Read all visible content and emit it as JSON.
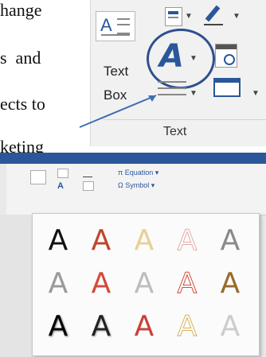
{
  "document": {
    "lines": [
      "hange",
      "s  and",
      "ects to",
      "keting"
    ]
  },
  "ribbon": {
    "text_box_label_1": "Text",
    "text_box_label_2": "Box",
    "text_box_icon_text": "A",
    "wordart_letter": "A",
    "group_label": "Text"
  },
  "inset": {
    "equation_label": "π Equation ▾",
    "symbol_label": "Ω Symbol ▾"
  },
  "gallery": {
    "rows": [
      [
        "A",
        "A",
        "A",
        "A",
        "A"
      ],
      [
        "A",
        "A",
        "A",
        "A",
        "A"
      ],
      [
        "A",
        "A",
        "A",
        "A",
        "A"
      ]
    ],
    "colors": [
      [
        "#111111",
        "#c0442e",
        "#e8cf95",
        "#e6a9a9",
        "#8a8a8a"
      ],
      [
        "#9a9a9a",
        "#d24a3a",
        "#bdbdbd",
        "#d24a3a",
        "#9a6a2a"
      ],
      [
        "#000000",
        "#222222",
        "#c8403a",
        "#f0d88a",
        "#cccccc"
      ]
    ]
  }
}
